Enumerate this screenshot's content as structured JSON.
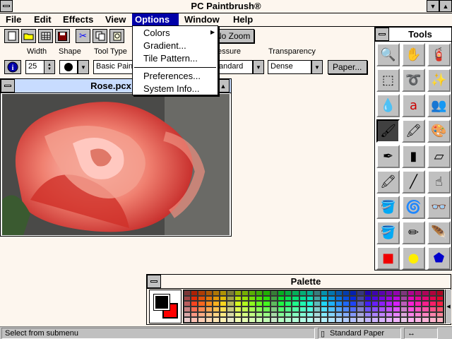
{
  "window": {
    "title": "PC Paintbrush®"
  },
  "menubar": {
    "items": [
      "File",
      "Edit",
      "Effects",
      "View",
      "Options",
      "Window",
      "Help"
    ],
    "active": "Options"
  },
  "options_menu": {
    "items": [
      "Colors",
      "Gradient...",
      "Tile Pattern...",
      "Preferences...",
      "System Info..."
    ]
  },
  "toolbar": {
    "zoom_label": "No Zoom"
  },
  "brush_labels": {
    "width": "Width",
    "shape": "Shape",
    "tool_type": "Tool Type",
    "pressure": "essure",
    "transparency": "Transparency"
  },
  "brush_controls": {
    "width_value": "25",
    "tool_type_value": "Basic Paint",
    "pressure_value": "andard",
    "transparency_value": "Dense",
    "paper_button": "Paper..."
  },
  "image_window": {
    "title": "Rose.pcx  10"
  },
  "tools_panel": {
    "title": "Tools",
    "tools": [
      "magnifier-tool",
      "hand-tool",
      "spray-can-tool",
      "rect-select-tool",
      "lasso-tool",
      "magic-wand-tool",
      "eyedropper-tool",
      "text-tool",
      "clone-tool",
      "paintbrush-tool",
      "highlighter-tool",
      "airbrush-tool",
      "pen-tool",
      "chalk-tool",
      "eraser-tool",
      "crayons-tool",
      "line-tool",
      "smear-tool",
      "fill-tool",
      "mixer-tool",
      "glasses-tool",
      "bucket-tool",
      "pencil-tool",
      "feather-tool",
      "rectangle-tool",
      "ellipse-tool",
      "shape-tool"
    ]
  },
  "palette": {
    "title": "Palette",
    "fg": "#000000",
    "bg": "#ff0000"
  },
  "status": {
    "message": "Select from submenu",
    "paper": "Standard Paper",
    "arrows": "↔"
  }
}
